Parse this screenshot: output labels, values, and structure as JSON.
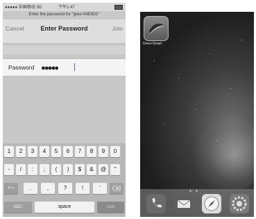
{
  "left_screen": {
    "status_bar": {
      "carrier": "●●●●● 中国移动  3G",
      "time": "下午1:47"
    },
    "prompt": "Enter the password for \"gree-04E9D1\"",
    "nav": {
      "cancel": "Cancel",
      "title": "Enter Password",
      "join": "Join"
    },
    "password_field": {
      "label": "Password",
      "value": "●●●●●"
    },
    "keyboard": {
      "row1": [
        "1",
        "2",
        "3",
        "4",
        "5",
        "6",
        "7",
        "8",
        "9",
        "0"
      ],
      "row2": [
        "-",
        "/",
        ":",
        ";",
        "(",
        ")",
        "$",
        "&",
        "@",
        "\""
      ],
      "row3": [
        ".",
        ",",
        "?",
        "!",
        "'"
      ],
      "more_symbols_key": "#+=",
      "abc_key": "ABC",
      "space_key": "space",
      "join_key": "Join"
    }
  },
  "right_screen": {
    "app": {
      "label": "Gree+Smart",
      "icon": "gree-leaf-icon"
    },
    "dock": [
      "phone-icon",
      "mail-icon",
      "safari-icon",
      "settings-icon"
    ]
  }
}
